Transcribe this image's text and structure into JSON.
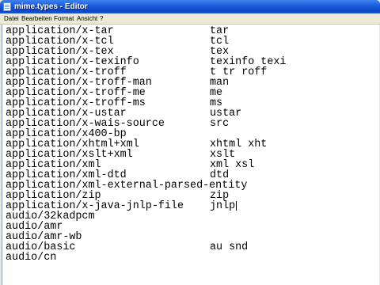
{
  "window": {
    "title": "mime.types - Editor",
    "icon": "notepad-icon"
  },
  "menu": [
    "Datei",
    "Bearbeiten",
    "Format",
    "Ansicht",
    "?"
  ],
  "editor": {
    "rows": [
      [
        "application/x-tar",
        "tar"
      ],
      [
        "application/x-tcl",
        "tcl"
      ],
      [
        "application/x-tex",
        "tex"
      ],
      [
        "application/x-texinfo",
        "texinfo texi"
      ],
      [
        "application/x-troff",
        "t tr roff"
      ],
      [
        "application/x-troff-man",
        "man"
      ],
      [
        "application/x-troff-me",
        "me"
      ],
      [
        "application/x-troff-ms",
        "ms"
      ],
      [
        "application/x-ustar",
        "ustar"
      ],
      [
        "application/x-wais-source",
        "src"
      ],
      [
        "application/x400-bp",
        ""
      ],
      [
        "application/xhtml+xml",
        "xhtml xht"
      ],
      [
        "application/xslt+xml",
        "xslt"
      ],
      [
        "application/xml",
        "xml xsl"
      ],
      [
        "application/xml-dtd",
        "dtd"
      ],
      [
        "application/xml-external-parsed-entity",
        ""
      ],
      [
        "application/zip",
        "zip"
      ],
      [
        "application/x-java-jnlp-file",
        "jnlp"
      ],
      [
        "audio/32kadpcm",
        ""
      ],
      [
        "audio/amr",
        ""
      ],
      [
        "audio/amr-wb",
        ""
      ],
      [
        "audio/basic",
        "au snd"
      ],
      [
        "audio/cn",
        ""
      ]
    ]
  }
}
